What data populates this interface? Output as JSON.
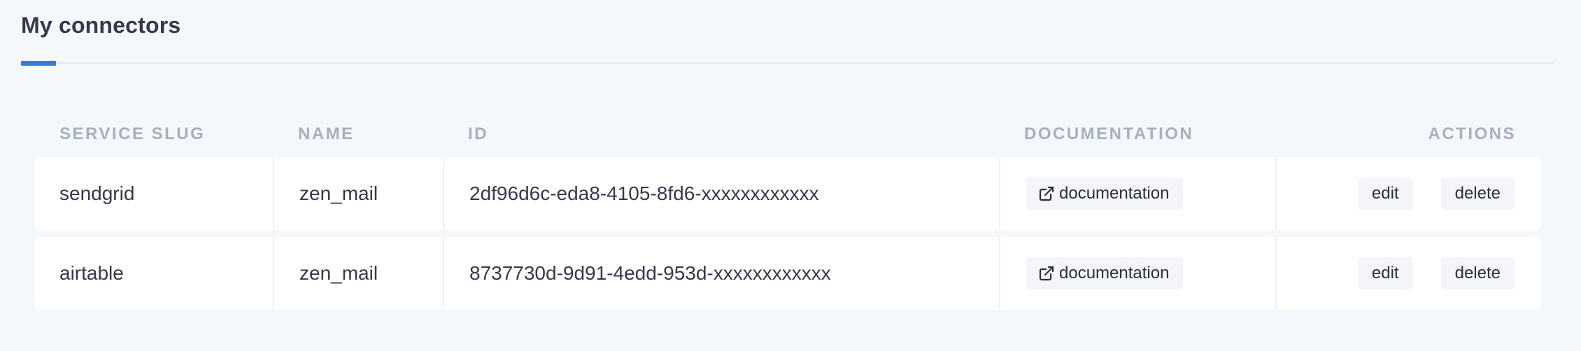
{
  "page": {
    "title": "My connectors"
  },
  "table": {
    "headers": {
      "service_slug": "SERVICE SLUG",
      "name": "NAME",
      "id": "ID",
      "documentation": "DOCUMENTATION",
      "actions": "ACTIONS"
    },
    "rows": [
      {
        "service_slug": "sendgrid",
        "name": "zen_mail",
        "id": "2df96d6c-eda8-4105-8fd6-xxxxxxxxxxxx",
        "documentation_label": "documentation",
        "edit_label": "edit",
        "delete_label": "delete"
      },
      {
        "service_slug": "airtable",
        "name": "zen_mail",
        "id": "8737730d-9d91-4edd-953d-xxxxxxxxxxxx",
        "documentation_label": "documentation",
        "edit_label": "edit",
        "delete_label": "delete"
      }
    ]
  },
  "icons": {
    "documentation": "external-link-icon"
  },
  "colors": {
    "accent": "#2f7de1",
    "background": "#f5f8fb",
    "row_background": "#ffffff",
    "header_text": "#a9b0bd",
    "button_background": "#f3f5f8"
  }
}
